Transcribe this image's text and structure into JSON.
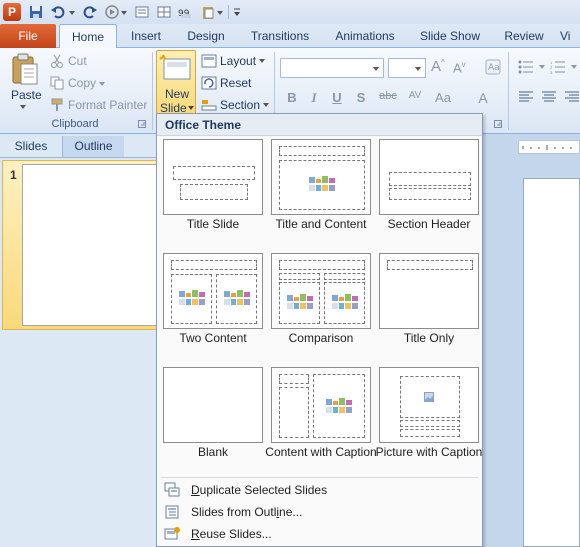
{
  "tabs": {
    "file": "File",
    "items": [
      "Home",
      "Insert",
      "Design",
      "Transitions",
      "Animations",
      "Slide Show",
      "Review",
      "Vi"
    ]
  },
  "ribbon": {
    "clipboard": {
      "paste": "Paste",
      "cut": "Cut",
      "copy": "Copy",
      "format_painter": "Format Painter",
      "group_label": "Clipboard"
    },
    "slides": {
      "new_slide_line1": "New",
      "new_slide_line2": "Slide",
      "layout": "Layout",
      "reset": "Reset",
      "section": "Section"
    },
    "font": {
      "bold": "B",
      "italic": "I",
      "underline": "U",
      "shadow": "S",
      "strike": "abc",
      "spacing": "AV",
      "case": "Aa",
      "color": "A"
    }
  },
  "left_pane": {
    "tab_slides": "Slides",
    "tab_outline": "Outline",
    "slide_number": "1"
  },
  "gallery": {
    "title": "Office Theme",
    "layouts": [
      {
        "label": "Title Slide"
      },
      {
        "label": "Title and Content"
      },
      {
        "label": "Section Header"
      },
      {
        "label": "Two Content"
      },
      {
        "label": "Comparison"
      },
      {
        "label": "Title Only"
      },
      {
        "label": "Blank"
      },
      {
        "label": "Content with Caption"
      },
      {
        "label": "Picture with Caption"
      }
    ],
    "menu": [
      {
        "prefix": "",
        "ul": "D",
        "rest": "uplicate Selected Slides"
      },
      {
        "prefix": "Slides from Outl",
        "ul": "i",
        "rest": "ne..."
      },
      {
        "prefix": "",
        "ul": "R",
        "rest": "euse Slides..."
      }
    ]
  },
  "colors": {
    "file_tab": "#d04a1c",
    "ribbon_bg": "#dbe6f4",
    "selected_button": "#f9d979"
  }
}
